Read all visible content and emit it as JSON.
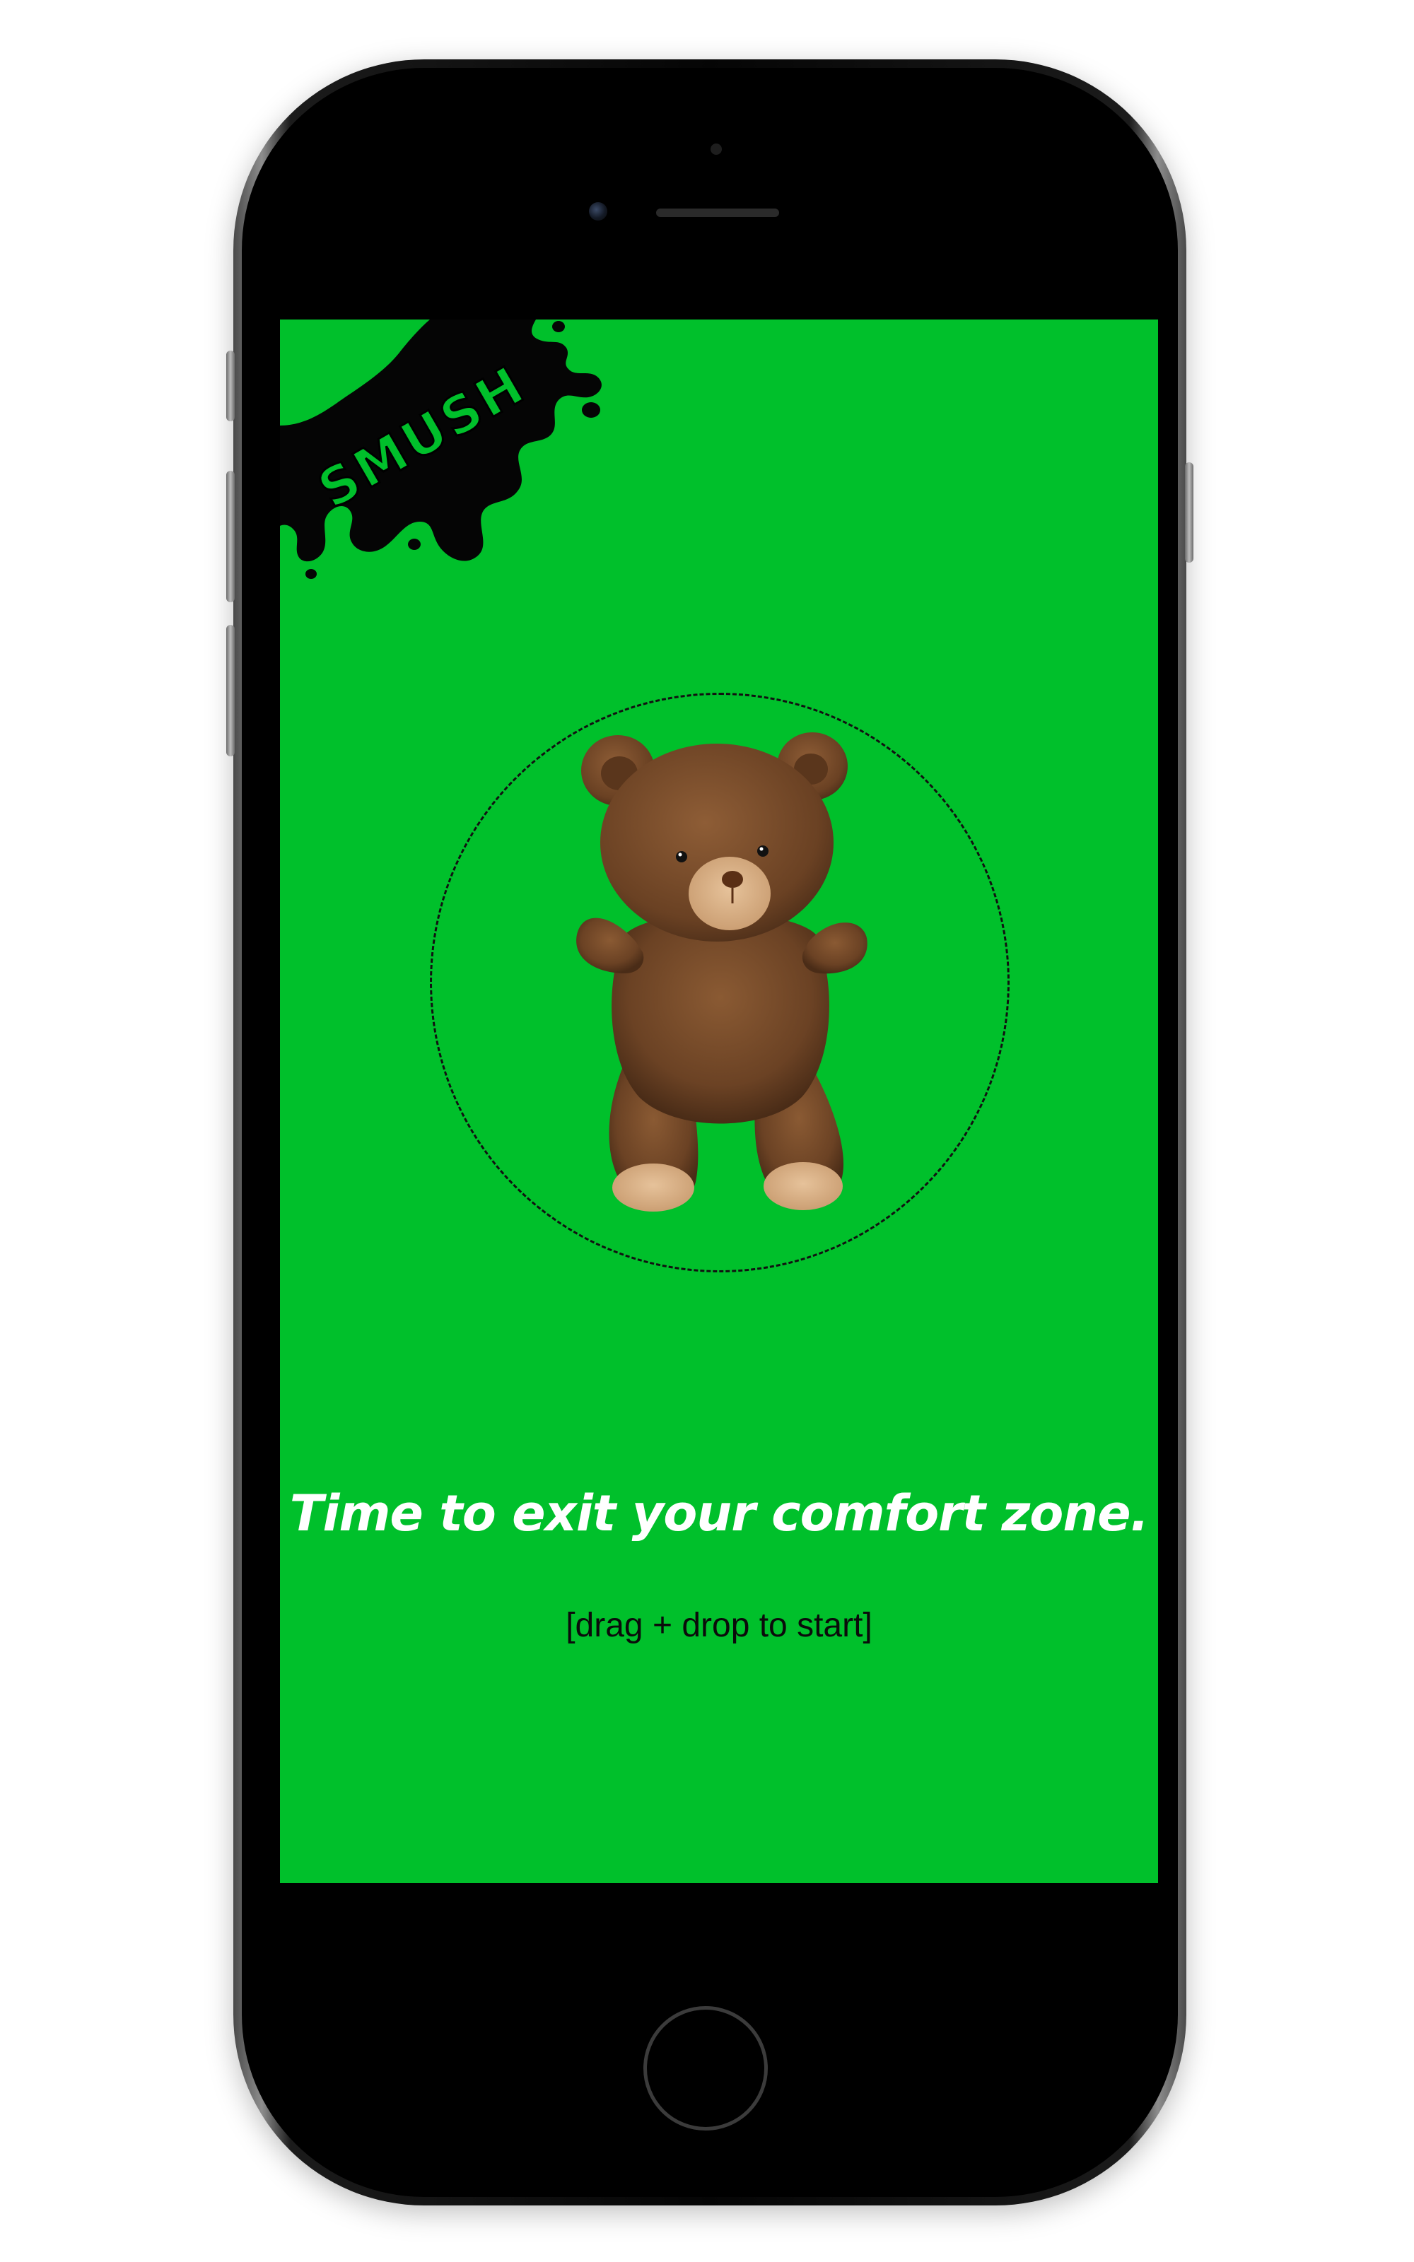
{
  "app": {
    "brand": "SMUSH"
  },
  "screen": {
    "background_color": "#00c02b",
    "headline": "Time to exit your comfort zone.",
    "instruction": "[drag + drop to start]"
  },
  "icons": {
    "draggable_item": "teddy-bear",
    "drop_target": "dashed-circle",
    "logo_shape": "ink-splat"
  }
}
